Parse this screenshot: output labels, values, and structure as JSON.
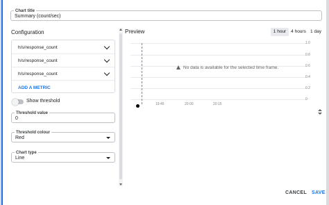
{
  "chart_title": {
    "label": "Chart title",
    "value": "Summary (count/sec)"
  },
  "configuration": {
    "heading": "Configuration",
    "metrics": [
      "h/s/response_count",
      "h/s/response_count",
      "h/s/response_count"
    ],
    "add_metric_label": "ADD A METRIC"
  },
  "threshold": {
    "toggle_label": "Show threshold",
    "toggle_on": false,
    "value_label": "Threshold value",
    "value": "0",
    "colour_label": "Threshold colour",
    "colour_value": "Red"
  },
  "chart_type": {
    "label": "Chart type",
    "value": "Line"
  },
  "preview": {
    "heading": "Preview",
    "ranges": [
      "1 hour",
      "4 hours",
      "1 day"
    ],
    "active_range": "1 hour",
    "no_data_message": "No data is available for the selected time frame.",
    "y_ticks": [
      "1.0",
      "0.8",
      "0.6",
      "0.4",
      "0.2",
      "0"
    ],
    "x_ticks": [
      "19:45",
      "20:00",
      "20:15"
    ]
  },
  "actions": {
    "cancel": "CANCEL",
    "save": "SAVE"
  },
  "colors": {
    "accent": "#1a73e8",
    "text": "#202124",
    "border": "#bdc1c6"
  }
}
